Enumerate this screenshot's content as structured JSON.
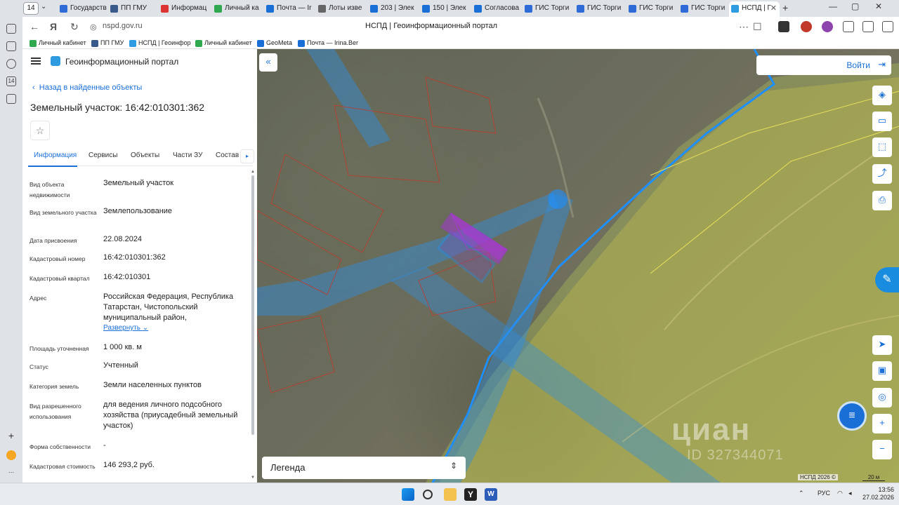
{
  "browser": {
    "tab_count": "14",
    "tabs": [
      {
        "label": "Государств",
        "color": "#2f6bd6"
      },
      {
        "label": "ПП ГМУ",
        "color": "#3a5a8c"
      },
      {
        "label": "Информац",
        "color": "#d33"
      },
      {
        "label": "Личный ка",
        "color": "#2fa84f"
      },
      {
        "label": "Почта — Ir",
        "color": "#1a6fd6"
      },
      {
        "label": "Лоты изве",
        "color": "#666"
      },
      {
        "label": "203 | Элек",
        "color": "#1a6fd6"
      },
      {
        "label": "150 | Элек",
        "color": "#1a6fd6"
      },
      {
        "label": "Согласова",
        "color": "#1a6fd6"
      },
      {
        "label": "ГИС Торги",
        "color": "#2f6bd6"
      },
      {
        "label": "ГИС Торги",
        "color": "#2f6bd6"
      },
      {
        "label": "ГИС Торги",
        "color": "#2f6bd6"
      },
      {
        "label": "ГИС Торги",
        "color": "#2f6bd6"
      },
      {
        "label": "НСПД | Г",
        "color": "#2f9be0"
      }
    ],
    "url": "nspd.gov.ru",
    "page_title": "НСПД | Геоинформационный портал",
    "bookmarks": [
      {
        "label": "Личный кабинет",
        "color": "#2fa84f"
      },
      {
        "label": "ПП ГМУ",
        "color": "#3a5a8c"
      },
      {
        "label": "НСПД | Геоинфор",
        "color": "#2f9be0"
      },
      {
        "label": "Личный кабинет",
        "color": "#2fa84f"
      },
      {
        "label": "GeoMeta",
        "color": "#1a6fd6"
      },
      {
        "label": "Почта — Irina.Ber",
        "color": "#1a6fd6"
      }
    ]
  },
  "panel": {
    "portal_name": "Геоинформационный портал",
    "back_link": "Назад в найденные объекты",
    "title": "Земельный участок: 16:42:010301:362",
    "tabs": [
      "Информация",
      "Сервисы",
      "Объекты",
      "Части ЗУ",
      "Состав"
    ],
    "attributes": [
      {
        "label": "Вид объекта недвижимости",
        "value": "Земельный участок"
      },
      {
        "label": "Вид земельного участка",
        "value": "Землепользование"
      },
      {
        "label": "Дата присвоения",
        "value": "22.08.2024"
      },
      {
        "label": "Кадастровый номер",
        "value": "16:42:010301:362"
      },
      {
        "label": "Кадастровый квартал",
        "value": "16:42:010301"
      },
      {
        "label": "Адрес",
        "value": "Российская Федерация, Республика Татарстан, Чистопольский муниципальный район,"
      },
      {
        "label": "Площадь уточненная",
        "value": "1 000 кв. м"
      },
      {
        "label": "Статус",
        "value": "Учтенный"
      },
      {
        "label": "Категория земель",
        "value": "Земли населенных пунктов"
      },
      {
        "label": "Вид разрешенного использования",
        "value": "для ведения личного подсобного хозяйства (приусадебный земельный участок)"
      },
      {
        "label": "Форма собственности",
        "value": "-"
      },
      {
        "label": "Кадастровая стоимость",
        "value": "146 293,2 руб."
      }
    ],
    "expand_label": "Развернуть"
  },
  "map": {
    "login_label": "Войти",
    "legend_label": "Легенда",
    "watermark": "циан",
    "watermark_id": "ID 327344071",
    "copyright": "НСПД 2026 ©",
    "scale": "20 м"
  },
  "taskbar": {
    "lang": "РУС",
    "time": "13:56",
    "date": "27.02.2026"
  }
}
